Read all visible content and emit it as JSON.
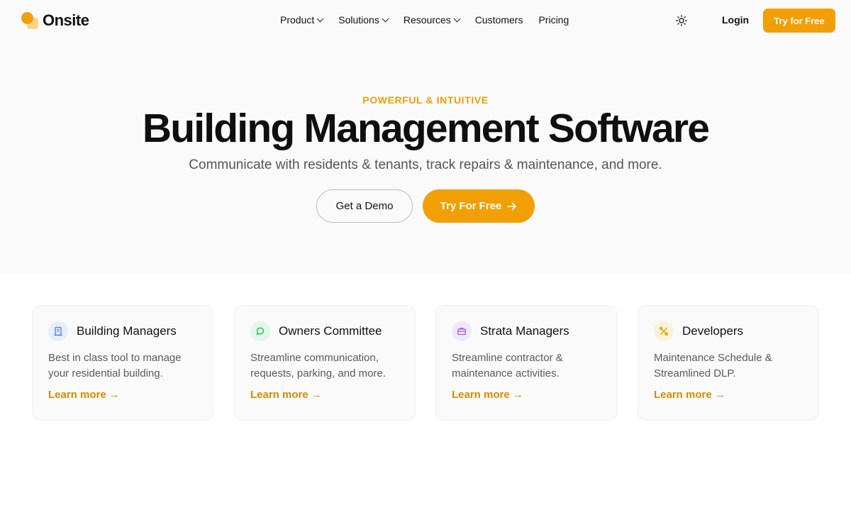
{
  "nav": {
    "brand": "Onsite",
    "menu": [
      {
        "label": "Product",
        "dropdown": true
      },
      {
        "label": "Solutions",
        "dropdown": true
      },
      {
        "label": "Resources",
        "dropdown": true
      },
      {
        "label": "Customers",
        "dropdown": false
      },
      {
        "label": "Pricing",
        "dropdown": false
      }
    ],
    "login": "Login",
    "cta": "Try for Free"
  },
  "hero": {
    "eyebrow": "POWERFUL & INTUITIVE",
    "title": "Building Management Software",
    "subtitle": "Communicate with residents & tenants, track repairs & maintenance, and more.",
    "demo_button": "Get a Demo",
    "try_button": "Try For Free"
  },
  "cards": [
    {
      "title": "Building Managers",
      "description": "Best in class tool to manage your residential building.",
      "link": "Learn more →",
      "icon": "building-icon",
      "icon_color": "#4f7be8",
      "icon_bg": "#e7eefc"
    },
    {
      "title": "Owners Committee",
      "description": "Streamline communication, requests, parking, and more.",
      "link": "Learn more →",
      "icon": "chat-icon",
      "icon_color": "#22b35f",
      "icon_bg": "#e2f6ea"
    },
    {
      "title": "Strata Managers",
      "description": "Streamline contractor & maintenance activities.",
      "link": "Learn more →",
      "icon": "briefcase-icon",
      "icon_color": "#a855f7",
      "icon_bg": "#f2e8fd"
    },
    {
      "title": "Developers",
      "description": "Maintenance Schedule & Streamlined DLP.",
      "link": "Learn more →",
      "icon": "tools-icon",
      "icon_color": "#e0a400",
      "icon_bg": "#fbf3d9"
    }
  ],
  "colors": {
    "accent": "#f29f05",
    "link": "#d98a02",
    "hero_bg": "#fafafa"
  }
}
